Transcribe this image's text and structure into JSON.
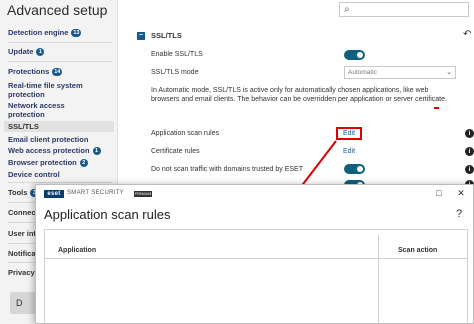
{
  "app": {
    "title": "Advanced setup"
  },
  "sidebar": {
    "items": [
      {
        "label": "Detection engine",
        "badge": "13"
      },
      {
        "label": "Update",
        "badge": "1"
      },
      {
        "label": "Protections",
        "badge": "14"
      },
      {
        "label": "Real-time file system"
      },
      {
        "label": "protection"
      },
      {
        "label": "Network access"
      },
      {
        "label": "protection"
      },
      {
        "label": "SSL/TLS"
      },
      {
        "label": "Email client protection"
      },
      {
        "label": "Web access protection",
        "badge": "1"
      },
      {
        "label": "Browser protection",
        "badge": "2"
      },
      {
        "label": "Device control"
      },
      {
        "label": "Tools",
        "badge": "3"
      },
      {
        "label": "Connect"
      },
      {
        "label": "User int"
      },
      {
        "label": "Notifica"
      },
      {
        "label": "Privacy s"
      }
    ],
    "default_button": "D"
  },
  "section": {
    "title": "SSL/TLS"
  },
  "settings": {
    "enable_label": "Enable SSL/TLS",
    "mode_label": "SSL/TLS mode",
    "mode_value": "Automatic",
    "description": "In Automatic mode, SSL/TLS is active only for automatically chosen applications, like web browsers and email clients. The behavior can be overridden per application or server certificate.",
    "app_scan_rules_label": "Application scan rules",
    "cert_rules_label": "Certificate rules",
    "edit_label": "Edit",
    "edit_label_2": "Edit",
    "trusted_label": "Do not scan traffic with domains trusted by ESET"
  },
  "dialog": {
    "logo": "eset",
    "brand": "SMART SECURITY",
    "brand_badge": "PREMIUM",
    "title": "Application scan rules",
    "help": "?",
    "columns": [
      "Application",
      "Scan action"
    ]
  },
  "colors": {
    "accent": "#0e5f80",
    "badge": "#1a5a8a",
    "highlight": "#e00000"
  }
}
